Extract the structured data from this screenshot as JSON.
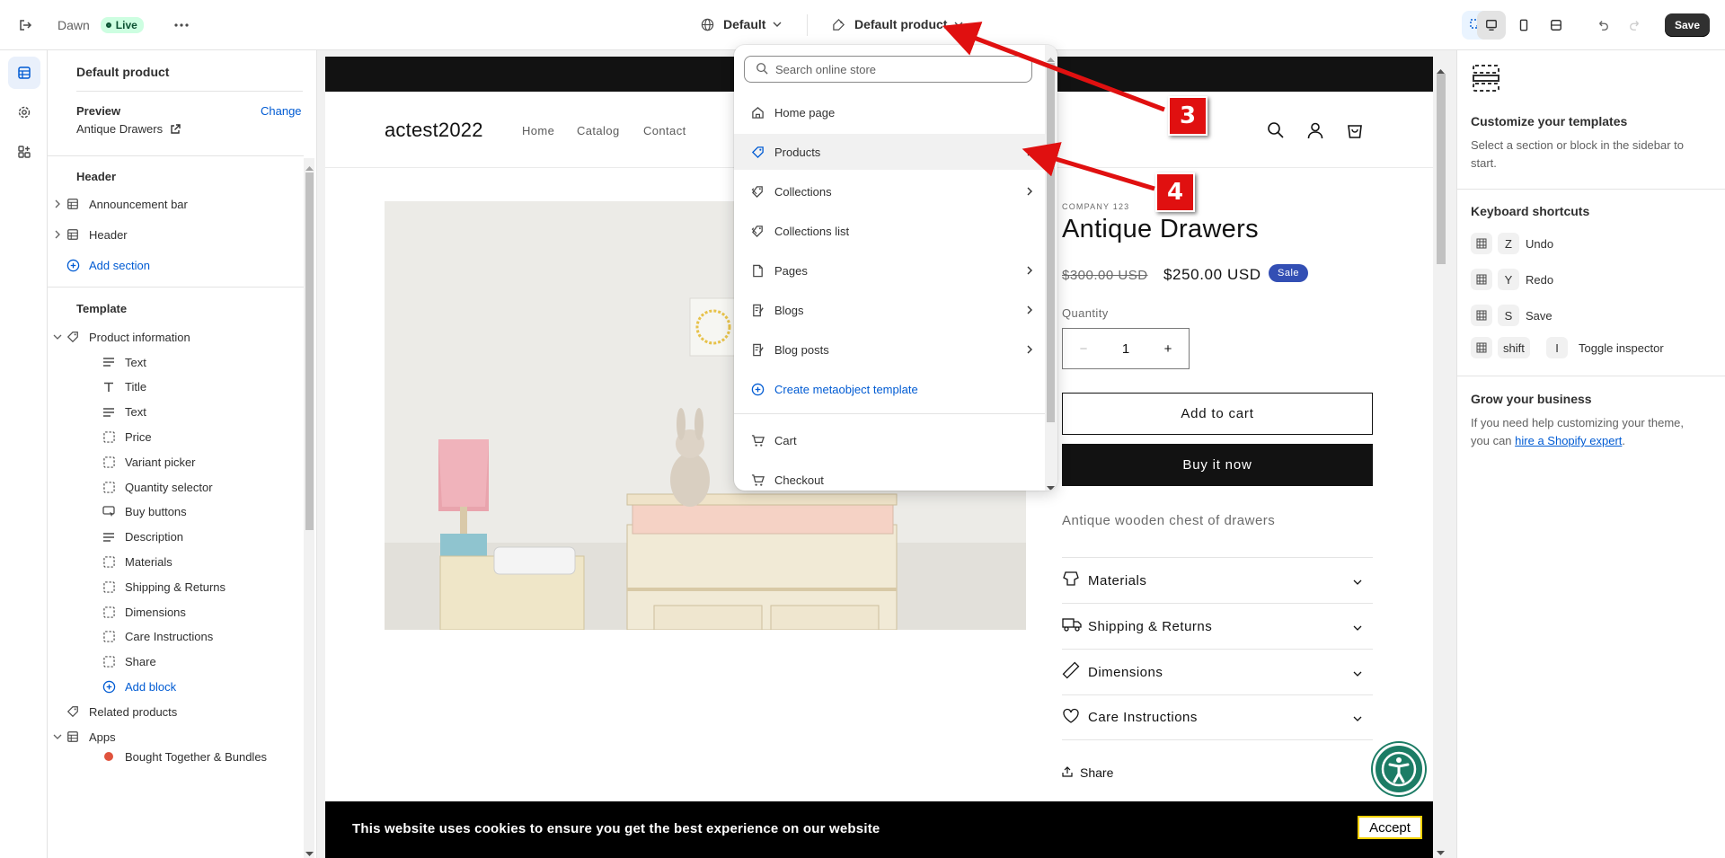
{
  "topbar": {
    "theme_name": "Dawn",
    "live_label": "Live",
    "locale_label": "Default",
    "template_label": "Default product",
    "save_label": "Save"
  },
  "sidebar": {
    "title": "Default product",
    "preview_label": "Preview",
    "preview_change": "Change",
    "preview_product": "Antique Drawers",
    "header_group": "Header",
    "header_items": [
      "Announcement bar",
      "Header"
    ],
    "add_section": "Add section",
    "template_group": "Template",
    "product_information": "Product information",
    "blocks": [
      "Text",
      "Title",
      "Text",
      "Price",
      "Variant picker",
      "Quantity selector",
      "Buy buttons",
      "Description",
      "Materials",
      "Shipping & Returns",
      "Dimensions",
      "Care Instructions",
      "Share"
    ],
    "add_block": "Add block",
    "related_products": "Related products",
    "apps": "Apps",
    "app_item": "Bought Together & Bundles"
  },
  "dropdown": {
    "search_placeholder": "Search online store",
    "items": [
      {
        "label": "Home page",
        "icon": "home-icon",
        "chevron": false
      },
      {
        "label": "Products",
        "icon": "tag-icon",
        "chevron": true
      },
      {
        "label": "Collections",
        "icon": "tags-icon",
        "chevron": true
      },
      {
        "label": "Collections list",
        "icon": "tags-icon",
        "chevron": false
      },
      {
        "label": "Pages",
        "icon": "page-icon",
        "chevron": true
      },
      {
        "label": "Blogs",
        "icon": "blog-icon",
        "chevron": true
      },
      {
        "label": "Blog posts",
        "icon": "blog-icon",
        "chevron": true
      }
    ],
    "create_metaobject": "Create metaobject template",
    "cart": "Cart",
    "checkout": "Checkout"
  },
  "store": {
    "logo": "actest2022",
    "nav": [
      "Home",
      "Catalog",
      "Contact"
    ],
    "vendor": "COMPANY 123",
    "product_title": "Antique Drawers",
    "compare_price": "$300.00 USD",
    "price": "$250.00 USD",
    "sale_badge": "Sale",
    "quantity_label": "Quantity",
    "quantity_value": "1",
    "add_to_cart": "Add to cart",
    "buy_now": "Buy it now",
    "description": "Antique wooden chest of drawers",
    "accordions": [
      "Materials",
      "Shipping & Returns",
      "Dimensions",
      "Care Instructions"
    ],
    "share": "Share",
    "cookie_text": "This website uses cookies to ensure you get the best experience on our website",
    "cookie_accept": "Accept"
  },
  "right_panel": {
    "heading": "Customize your templates",
    "subtext": "Select a section or block in the sidebar to start.",
    "shortcuts_heading": "Keyboard shortcuts",
    "shortcuts": [
      {
        "key": "Z",
        "label": "Undo"
      },
      {
        "key": "Y",
        "label": "Redo"
      },
      {
        "key": "S",
        "label": "Save"
      }
    ],
    "inspector_keys": [
      "shift",
      "I"
    ],
    "inspector_label": "Toggle inspector",
    "grow_heading": "Grow your business",
    "grow_text_1": "If you need help customizing your theme, you can ",
    "grow_link": "hire a Shopify expert",
    "grow_text_2": "."
  },
  "annotations": {
    "step_3": "3",
    "step_4": "4"
  },
  "colors": {
    "accent_blue": "#005bd3",
    "live_badge": "#cdfee1",
    "annotation_red": "#e01010",
    "sale_badge": "#334fb4"
  }
}
